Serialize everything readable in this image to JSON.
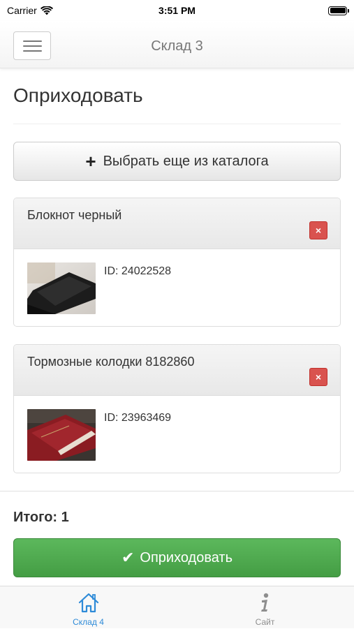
{
  "status_bar": {
    "carrier": "Carrier",
    "time": "3:51 PM"
  },
  "navbar": {
    "title": "Склад 3"
  },
  "page": {
    "title": "Оприходовать"
  },
  "catalog_button": {
    "label": "Выбрать еще из каталога"
  },
  "items": [
    {
      "name": "Блокнот черный",
      "id_text": "ID: 24022528",
      "delete_label": "×"
    },
    {
      "name": "Тормозные колодки 8182860",
      "id_text": "ID: 23963469",
      "delete_label": "×"
    }
  ],
  "summary": {
    "total": "Итого: 1"
  },
  "submit_button": {
    "label": "Оприходовать"
  },
  "tab_bar": {
    "tabs": [
      {
        "label": "Склад 4",
        "icon": "home-icon",
        "active": true
      },
      {
        "label": "Сайт",
        "icon": "info-icon",
        "active": false
      }
    ]
  },
  "colors": {
    "accent_green": "#5cb85c",
    "danger_red": "#d9534f",
    "tab_active_blue": "#2e8bd8"
  }
}
